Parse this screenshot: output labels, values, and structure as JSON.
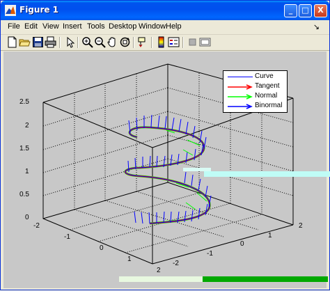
{
  "window": {
    "title": "Figure 1",
    "controls": [
      "_",
      "□",
      "X"
    ]
  },
  "menu": {
    "items": [
      "File",
      "Edit",
      "View",
      "Insert",
      "Tools",
      "Desktop",
      "Window",
      "Help"
    ],
    "dock_glyph": "↘"
  },
  "toolbar": {
    "icons": [
      "new-figure-icon",
      "open-file-icon",
      "save-icon",
      "print-icon",
      "edit-plot-icon",
      "zoom-in-icon",
      "zoom-out-icon",
      "pan-icon",
      "rotate-3d-icon",
      "data-cursor-icon",
      "colorbar-icon",
      "legend-icon",
      "hide-plot-tools-icon",
      "show-plot-tools-icon"
    ]
  },
  "plot": {
    "legend": [
      {
        "label": "Curve",
        "color": "#0000ff"
      },
      {
        "label": "Tangent",
        "color": "#ff0000"
      },
      {
        "label": "Normal",
        "color": "#00ff00"
      },
      {
        "label": "Binormal",
        "color": "#0000ff"
      }
    ],
    "z_ticks": [
      "0",
      "0.5",
      "1",
      "1.5",
      "2",
      "2.5"
    ],
    "x_ticks": [
      "-2",
      "-1",
      "0",
      "1",
      "2"
    ],
    "y_ticks": [
      "-2",
      "-1",
      "0",
      "1",
      "2"
    ]
  },
  "colors": {
    "curve": "#0000ff",
    "tangent": "#ff0000",
    "normal": "#00ff00",
    "binormal": "#0000ff",
    "title_bar": "#0053ee"
  }
}
